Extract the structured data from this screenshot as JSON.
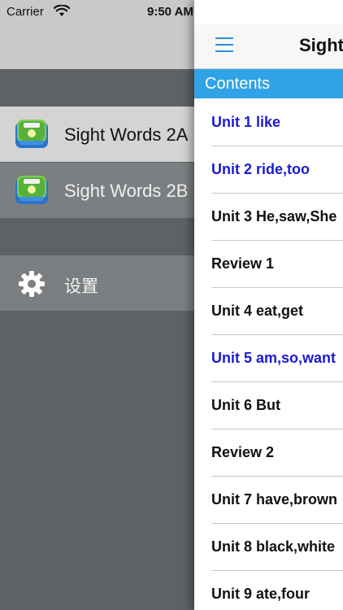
{
  "status_bar": {
    "carrier": "Carrier",
    "time": "9:50 AM"
  },
  "side_menu": {
    "items": [
      {
        "label": "Sight Words 2A",
        "icon": "app-icon"
      },
      {
        "label": "Sight Words 2B",
        "icon": "app-icon"
      },
      {
        "label": "设置",
        "icon": "gear-icon"
      }
    ]
  },
  "panel": {
    "title": "Sight",
    "contents_label": "Contents",
    "units": [
      {
        "label": "Unit 1 like",
        "color": "#1a1ad6"
      },
      {
        "label": "Unit 2 ride,too",
        "color": "#1a1ad6"
      },
      {
        "label": "Unit 3 He,saw,She",
        "color": "#111111"
      },
      {
        "label": "Review 1",
        "color": "#111111"
      },
      {
        "label": "Unit 4 eat,get",
        "color": "#111111"
      },
      {
        "label": "Unit 5 am,so,want",
        "color": "#1a1ad6"
      },
      {
        "label": "Unit 6 But",
        "color": "#111111"
      },
      {
        "label": "Review 2",
        "color": "#111111"
      },
      {
        "label": "Unit 7 have,brown",
        "color": "#111111"
      },
      {
        "label": "Unit 8 black,white",
        "color": "#111111"
      },
      {
        "label": "Unit 9 ate,four",
        "color": "#111111"
      }
    ]
  },
  "colors": {
    "accent": "#30a3e6",
    "hamburger": "#2f8ee5",
    "link_blue": "#1a1ad6",
    "menu_background": "#5f6264"
  }
}
